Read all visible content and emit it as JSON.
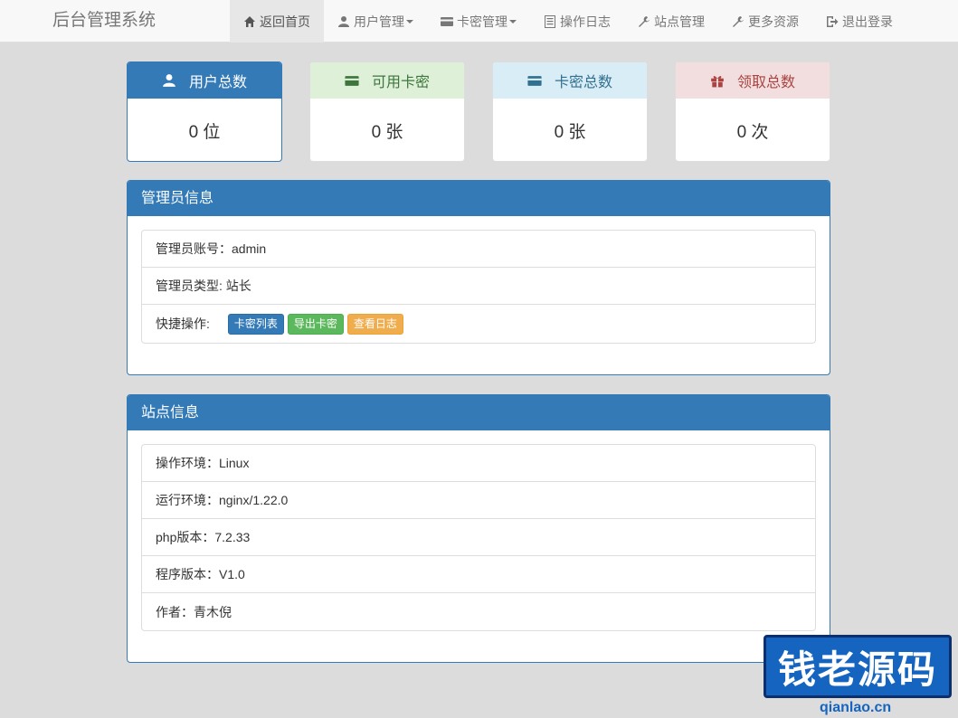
{
  "navbar": {
    "brand": "后台管理系统",
    "items": [
      {
        "label": "返回首页"
      },
      {
        "label": "用户管理"
      },
      {
        "label": "卡密管理"
      },
      {
        "label": "操作日志"
      },
      {
        "label": "站点管理"
      },
      {
        "label": "更多资源"
      },
      {
        "label": "退出登录"
      }
    ]
  },
  "stats": [
    {
      "title": "用户总数",
      "value": "0 位",
      "icon": "user-icon"
    },
    {
      "title": "可用卡密",
      "value": "0 张",
      "icon": "credit-card-icon"
    },
    {
      "title": "卡密总数",
      "value": "0 张",
      "icon": "credit-card-icon"
    },
    {
      "title": "领取总数",
      "value": "0 次",
      "icon": "gift-icon"
    }
  ],
  "admin_panel": {
    "title": "管理员信息",
    "account_label": "管理员账号：admin",
    "type_label": "管理员类型: 站长",
    "quick_label": "快捷操作:",
    "buttons": {
      "card_list": "卡密列表",
      "export_cards": "导出卡密",
      "view_logs": "查看日志"
    }
  },
  "site_panel": {
    "title": "站点信息",
    "rows": [
      "操作环境：Linux",
      "运行环境：nginx/1.22.0",
      "php版本：7.2.33",
      "程序版本：V1.0",
      "作者：青木倪"
    ]
  },
  "watermark": {
    "text": "钱老源码",
    "url": "qianlao.cn"
  },
  "colors": {
    "primary": "#337ab7",
    "success": "#5cb85c",
    "warning": "#f0ad4e",
    "danger_bg": "#f2dede",
    "info_bg": "#d9edf7",
    "success_bg": "#dff0d8"
  }
}
